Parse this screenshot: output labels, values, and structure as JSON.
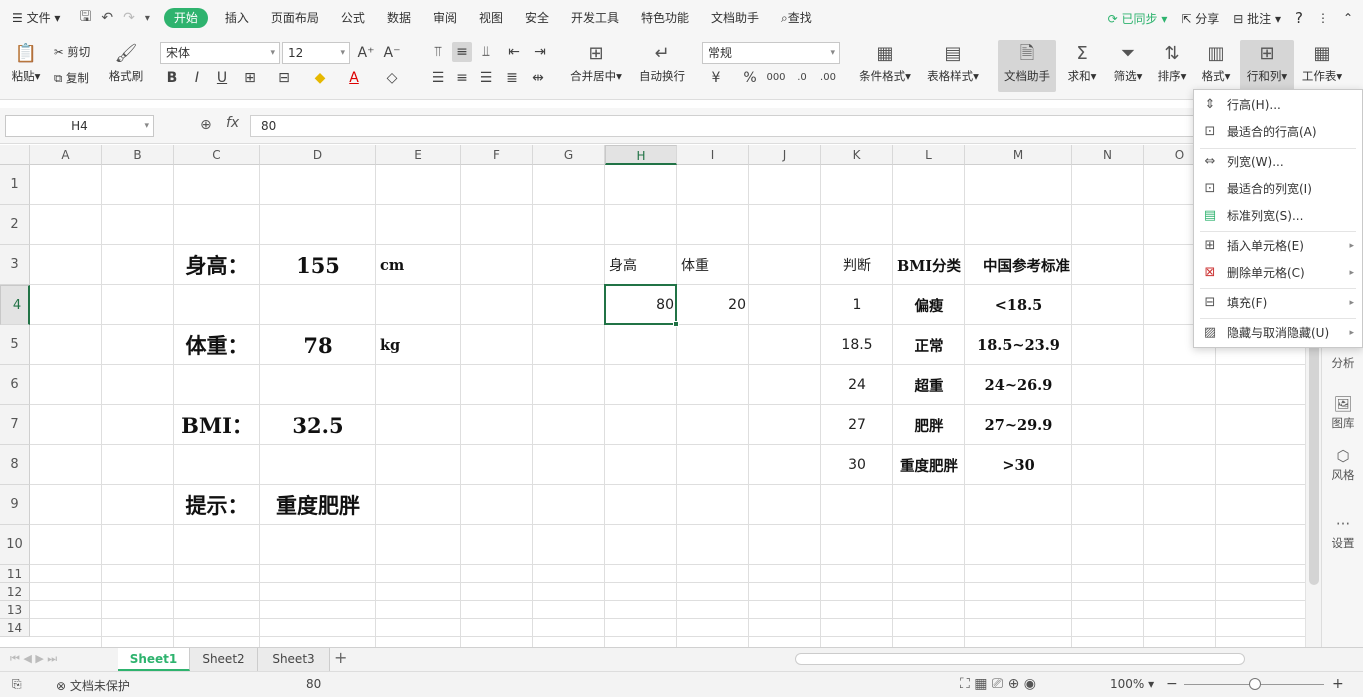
{
  "menubar": {
    "file": "文件",
    "tabs": [
      "开始",
      "插入",
      "页面布局",
      "公式",
      "数据",
      "审阅",
      "视图",
      "安全",
      "开发工具",
      "特色功能",
      "文档助手"
    ],
    "active_tab": "开始",
    "search": "查找",
    "synced": "已同步",
    "share": "分享",
    "comment": "批注"
  },
  "ribbon": {
    "paste": "粘贴",
    "cut": "剪切",
    "copy": "复制",
    "format_painter": "格式刷",
    "font_name": "宋体",
    "font_size": "12",
    "merge_center": "合并居中",
    "wrap_text": "自动换行",
    "number_format": "常规",
    "cond_format": "条件格式",
    "table_style": "表格样式",
    "doc_assistant": "文档助手",
    "sum": "求和",
    "filter": "筛选",
    "sort": "排序",
    "format": "格式",
    "row_col": "行和列",
    "worksheet": "工作表"
  },
  "formula_bar": {
    "name_box": "H4",
    "fx": "fx",
    "value": "80"
  },
  "columns": [
    "A",
    "B",
    "C",
    "D",
    "E",
    "F",
    "G",
    "H",
    "I",
    "J",
    "K",
    "L",
    "M",
    "N",
    "O"
  ],
  "rows": [
    "1",
    "2",
    "3",
    "4",
    "5",
    "6",
    "7",
    "8",
    "9",
    "10",
    "11",
    "12",
    "13",
    "14"
  ],
  "cells": {
    "C3": "身高：",
    "D3": "155",
    "E3": "cm",
    "C5": "体重：",
    "D5": "78",
    "E5": "kg",
    "C7": "BMI：",
    "D7": "32.5",
    "C9": "提示：",
    "D9": "重度肥胖",
    "H3": "身高",
    "I3": "体重",
    "H4": "80",
    "I4": "20",
    "K3": "判断",
    "L3": "BMI分类",
    "M3": "中国参考标准",
    "K4": "1",
    "L4": "偏瘦",
    "M4": "<18.5",
    "K5": "18.5",
    "L5": "正常",
    "M5": "18.5~23.9",
    "K6": "24",
    "L6": "超重",
    "M6": "24~26.9",
    "K7": "27",
    "L7": "肥胖",
    "M7": "27~29.9",
    "K8": "30",
    "L8": "重度肥胖",
    "M8": ">30"
  },
  "sidebar": [
    "分析",
    "图库",
    "风格",
    "设置"
  ],
  "context_menu": {
    "items": [
      "行高(H)...",
      "最适合的行高(A)",
      "列宽(W)...",
      "最适合的列宽(I)",
      "标准列宽(S)...",
      "插入单元格(E)",
      "删除单元格(C)",
      "填充(F)",
      "隐藏与取消隐藏(U)"
    ]
  },
  "sheets": [
    "Sheet1",
    "Sheet2",
    "Sheet3"
  ],
  "active_sheet": "Sheet1",
  "status": {
    "protect": "文档未保护",
    "value": "80",
    "zoom": "100%"
  }
}
